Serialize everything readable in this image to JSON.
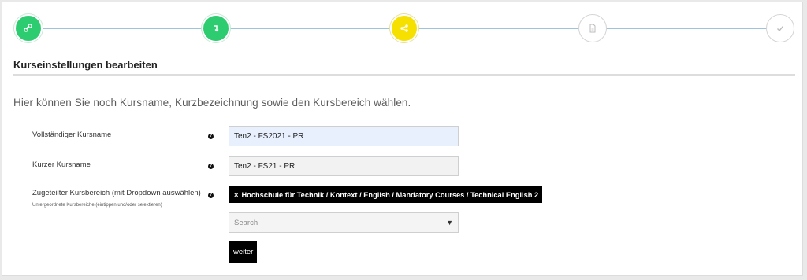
{
  "stepper": {
    "steps": [
      {
        "name": "step-1",
        "status": "done",
        "icon": "link-icon"
      },
      {
        "name": "step-2",
        "status": "done",
        "icon": "return-arrow-icon"
      },
      {
        "name": "step-3",
        "status": "active",
        "icon": "share-icon"
      },
      {
        "name": "step-4",
        "status": "todo",
        "icon": "document-icon"
      },
      {
        "name": "step-5",
        "status": "todo",
        "icon": "checkmark-icon"
      }
    ],
    "colors": {
      "done": "#2ecc71",
      "active": "#f6e000",
      "line": "#9ec3dc"
    }
  },
  "section": {
    "title": "Kurseinstellungen bearbeiten",
    "intro": "Hier können Sie noch Kursname, Kurzbezeichnung sowie den Kursbereich wählen."
  },
  "form": {
    "fullname": {
      "label": "Vollständiger Kursname",
      "value": "Ten2 - FS2021 - PR"
    },
    "shortname": {
      "label": "Kurzer Kursname",
      "value": "Ten2 - FS21 - PR"
    },
    "category": {
      "label": "Zugeteilter Kursbereich (mit Dropdown auswählen)",
      "sublabel": "Untergeordnete Kursbereiche (eintippen und/oder selektieren)",
      "selected_tag": "Hochschule für Technik / Kontext / English / Mandatory Courses / Technical English 2",
      "tag_remove": "×",
      "search_placeholder": "Search",
      "caret": "▼"
    },
    "help_glyph": "?"
  },
  "actions": {
    "next_label": "weiter"
  }
}
